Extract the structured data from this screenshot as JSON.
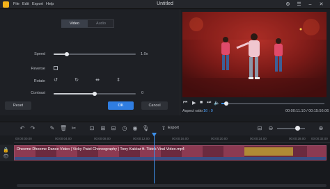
{
  "window": {
    "title": "Untitled",
    "menu": [
      "File",
      "Edit",
      "Export",
      "Help"
    ]
  },
  "editor": {
    "tabs": [
      "Video",
      "Audio"
    ],
    "speed": {
      "label": "Speed",
      "value": "1.0x",
      "level": 0.16
    },
    "reverse": {
      "label": "Reverse",
      "checked": false
    },
    "rotate": {
      "label": "Rotate",
      "icons": [
        "rotate-left-icon",
        "rotate-right-icon",
        "flip-horizontal-icon",
        "flip-vertical-icon"
      ]
    },
    "contrast": {
      "label": "Contrast",
      "value": "0",
      "level": 0.5
    },
    "buttons": {
      "reset": "Reset",
      "ok": "OK",
      "cancel": "Cancel"
    }
  },
  "preview": {
    "aspect_label": "Aspect ratio",
    "aspect_value": "16 : 9",
    "timecode": "00:00:11.10 / 00:15:56.06",
    "progress": 0.05
  },
  "timeline": {
    "export_label": "Export",
    "ruler_ticks": [
      "00:00:00.00",
      "00:00:04.00",
      "00:00:08.00",
      "00:00:12.00",
      "00:00:16.00",
      "00:00:20.00",
      "00:00:24.00",
      "00:00:28.00",
      "00:00:32.00"
    ],
    "clip_name": "Dheeme Dheeme Dance Video | Vicky Patel Choreography | Tony Kakkar ft. Tiktok Viral Video.mp4"
  },
  "colors": {
    "accent": "#2f7de1",
    "clip": "#6b2a3f",
    "logo": "#f3b21a"
  }
}
